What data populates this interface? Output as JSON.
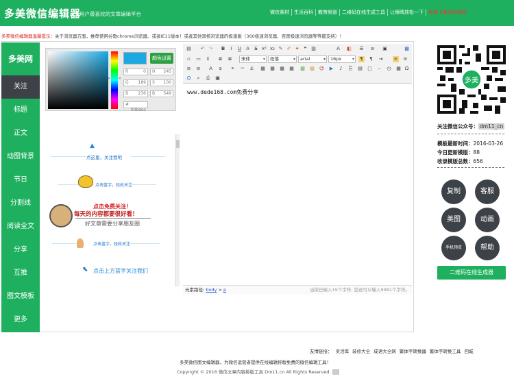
{
  "header": {
    "logo": "多美微信编辑器",
    "tagline": "用户最喜欢的文章编辑平台",
    "nav": [
      "微信素材",
      "生活百科",
      "教育频道",
      "二维码在线生成工具",
      "让眼睛放松一下"
    ],
    "nav_red": "免费下载本站源码"
  },
  "notice": {
    "label": "多美微信编辑器温馨提示：",
    "text": "关于浏览器方面，推荐使用谷歌chrome浏览器、或者IE11版本！或者其他双核浏览器的极速版（360极速浏览器、百度极速浏览器等等都支持）！"
  },
  "sidebar": {
    "brand": "多美网",
    "items": [
      "关注",
      "标题",
      "正文",
      "动图背景",
      "节日",
      "分割线",
      "阅读全文",
      "分享",
      "互推",
      "图文模板",
      "更多"
    ]
  },
  "picker": {
    "set_button": "颜色设置",
    "hue_left": "»",
    "hue_right": "«",
    "fields": [
      {
        "k": "R",
        "v": "0"
      },
      {
        "k": "H",
        "v": "245"
      },
      {
        "k": "G",
        "v": "189"
      },
      {
        "k": "S",
        "v": "100"
      },
      {
        "k": "B",
        "v": "236"
      },
      {
        "k": "B",
        "v": "549"
      },
      {
        "k": "#",
        "v": "00bdec"
      }
    ],
    "color_main": "#1ba8e3"
  },
  "templates": {
    "t1": "点这里，关注我吧",
    "t2": "点击蓝字，轻松关注",
    "t3a": "点击免费关注！",
    "t3b": "每天的内容都要很好看！",
    "t3c": "好文章需要分享朋友圈",
    "t4": "点击蓝字，轻松关注",
    "t5": "点击上方蓝字关注我们"
  },
  "toolbar": {
    "font_name": "宋体",
    "heading": "段落",
    "font_family": "arial",
    "font_size": "16px",
    "a_label": "A"
  },
  "editor": {
    "content": "www.dede168.com免费分享"
  },
  "status": {
    "path_label": "元素路径:",
    "path_body": "body",
    "path_sep": ">",
    "path_p": "p",
    "count": "当前已输入19个字符, 您还可以输入9981个字符。"
  },
  "right": {
    "follow_label": "关注微信公众号：",
    "follow_code": "dm11_cn",
    "qr_center": "多美",
    "stats": [
      {
        "label": "模板最新时间：",
        "value": "2016-03-26"
      },
      {
        "label": "今日更新模版：",
        "value": "88"
      },
      {
        "label": "收录模版总数：",
        "value": "656"
      }
    ],
    "buttons": [
      "复制",
      "客服",
      "美图",
      "动画",
      "手机预览",
      "帮助"
    ],
    "qr_button": "二维码在线生成器"
  },
  "footer": {
    "links_label": "友情链接：",
    "links": [
      "灵活库",
      "装修大全",
      "成语大全网",
      "繁体字转换器",
      "繁体字转换工具",
      "回城"
    ],
    "line1": "多美微信图文编辑器，为微信运营者提供在线编辑排版免费的微信编辑工具！",
    "copyright": "Copyright © 2016 微信文章内容排版工具 Dm11.cn All Rights Reserved."
  },
  "colors": {
    "brand_green": "#1eb05f",
    "dark_gray": "#3d4148",
    "accent_blue": "#1ba8e3"
  }
}
